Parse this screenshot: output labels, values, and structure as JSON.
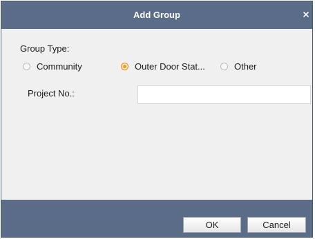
{
  "dialog": {
    "title": "Add Group",
    "close_icon": "close-icon"
  },
  "group_type": {
    "label": "Group Type:",
    "options": [
      {
        "label": "Community",
        "selected": false
      },
      {
        "label": "Outer Door Stat...",
        "selected": true
      },
      {
        "label": "Other",
        "selected": false
      }
    ]
  },
  "project": {
    "label": "Project No.:",
    "value": "",
    "placeholder": ""
  },
  "footer": {
    "ok_label": "OK",
    "cancel_label": "Cancel"
  },
  "colors": {
    "header_bg": "#5b6c89",
    "body_bg": "#f0f0f0",
    "radio_selected": "#f19a1f"
  }
}
